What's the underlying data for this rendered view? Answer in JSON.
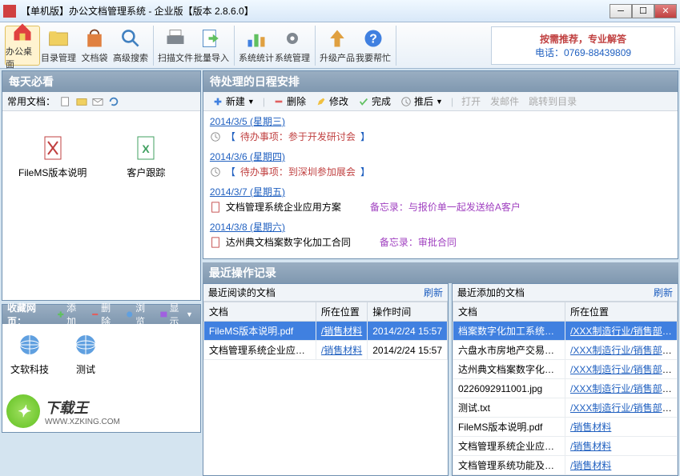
{
  "titlebar": {
    "text": "【单机版】办公文档管理系统 - 企业版【版本 2.8.6.0】"
  },
  "toolbar": {
    "items": [
      {
        "label": "办公桌面",
        "icon": "home"
      },
      {
        "label": "目录管理",
        "icon": "folder"
      },
      {
        "label": "文档袋",
        "icon": "bag"
      },
      {
        "label": "高级搜索",
        "icon": "search"
      },
      {
        "label": "扫描文件",
        "icon": "scan"
      },
      {
        "label": "批量导入",
        "icon": "import"
      },
      {
        "label": "系统统计",
        "icon": "stats"
      },
      {
        "label": "系统管理",
        "icon": "gear"
      },
      {
        "label": "升级产品",
        "icon": "upgrade"
      },
      {
        "label": "我要帮忙",
        "icon": "help"
      }
    ]
  },
  "banner": {
    "line1": "按需推荐，专业解答",
    "line2": "电话：0769-88439809"
  },
  "mustread": {
    "title": "每天必看",
    "sub_label": "常用文档：",
    "files": [
      {
        "label": "FileMS版本说明",
        "type": "pdf"
      },
      {
        "label": "客户跟踪",
        "type": "xls"
      }
    ]
  },
  "favorites": {
    "label": "收藏网页：",
    "btns": {
      "add": "添加",
      "delete": "删除",
      "browse": "浏览",
      "show": "显示"
    },
    "items": [
      {
        "label": "文软科技"
      },
      {
        "label": "测试"
      }
    ]
  },
  "schedule": {
    "title": "待处理的日程安排",
    "toolbar": {
      "new": "新建",
      "delete": "删除",
      "edit": "修改",
      "done": "完成",
      "postpone": "推后",
      "open": "打开",
      "mail": "发邮件",
      "jump": "跳转到目录"
    },
    "rows": [
      {
        "date": "2014/3/5 (星期三)",
        "items": [
          {
            "type": "todo",
            "text": "【待办事项：参于开发研讨会】",
            "memo": ""
          }
        ]
      },
      {
        "date": "2014/3/6 (星期四)",
        "items": [
          {
            "type": "todo",
            "text": "【待办事项：到深圳参加展会】",
            "memo": ""
          }
        ]
      },
      {
        "date": "2014/3/7 (星期五)",
        "items": [
          {
            "type": "doc",
            "text": "文档管理系统企业应用方案",
            "memo": "备忘录：与报价单一起发送给A客户"
          }
        ]
      },
      {
        "date": "2014/3/8 (星期六)",
        "items": [
          {
            "type": "doc",
            "text": "达州典文档案数字化加工合同",
            "memo": "备忘录：审批合同"
          }
        ]
      }
    ]
  },
  "recent": {
    "title": "最近操作记录",
    "refresh": "刷新",
    "read": {
      "title": "最近阅读的文档",
      "cols": [
        "文档",
        "所在位置",
        "操作时间"
      ],
      "rows": [
        {
          "doc": "FileMS版本说明.pdf",
          "loc": "/销售材料",
          "time": "2014/2/24 15:57",
          "selected": true
        },
        {
          "doc": "文档管理系统企业应用方案.pdf",
          "loc": "/销售材料",
          "time": "2014/2/24 15:57"
        }
      ]
    },
    "added": {
      "title": "最近添加的文档",
      "cols": [
        "文档",
        "所在位置"
      ],
      "rows": [
        {
          "doc": "档案数字化加工系统合同.doc",
          "loc": "/XXX制造行业/销售部/销",
          "selected": true
        },
        {
          "doc": "六盘水市房地产交易中心档案数字...",
          "loc": "/XXX制造行业/销售部/销"
        },
        {
          "doc": "达州典文档案数字化加工合同.pdf",
          "loc": "/XXX制造行业/销售部/销"
        },
        {
          "doc": "0226092911001.jpg",
          "loc": "/XXX制造行业/销售部/销"
        },
        {
          "doc": "测试.txt",
          "loc": "/XXX制造行业/销售部/销"
        },
        {
          "doc": "FileMS版本说明.pdf",
          "loc": "/销售材料"
        },
        {
          "doc": "文档管理系统企业应用方案.pdf",
          "loc": "/销售材料"
        },
        {
          "doc": "文档管理系统功能及报价.doc",
          "loc": "/销售材料"
        }
      ]
    }
  },
  "watermark": {
    "name": "下载王",
    "url": "WWW.XZKING.COM"
  }
}
